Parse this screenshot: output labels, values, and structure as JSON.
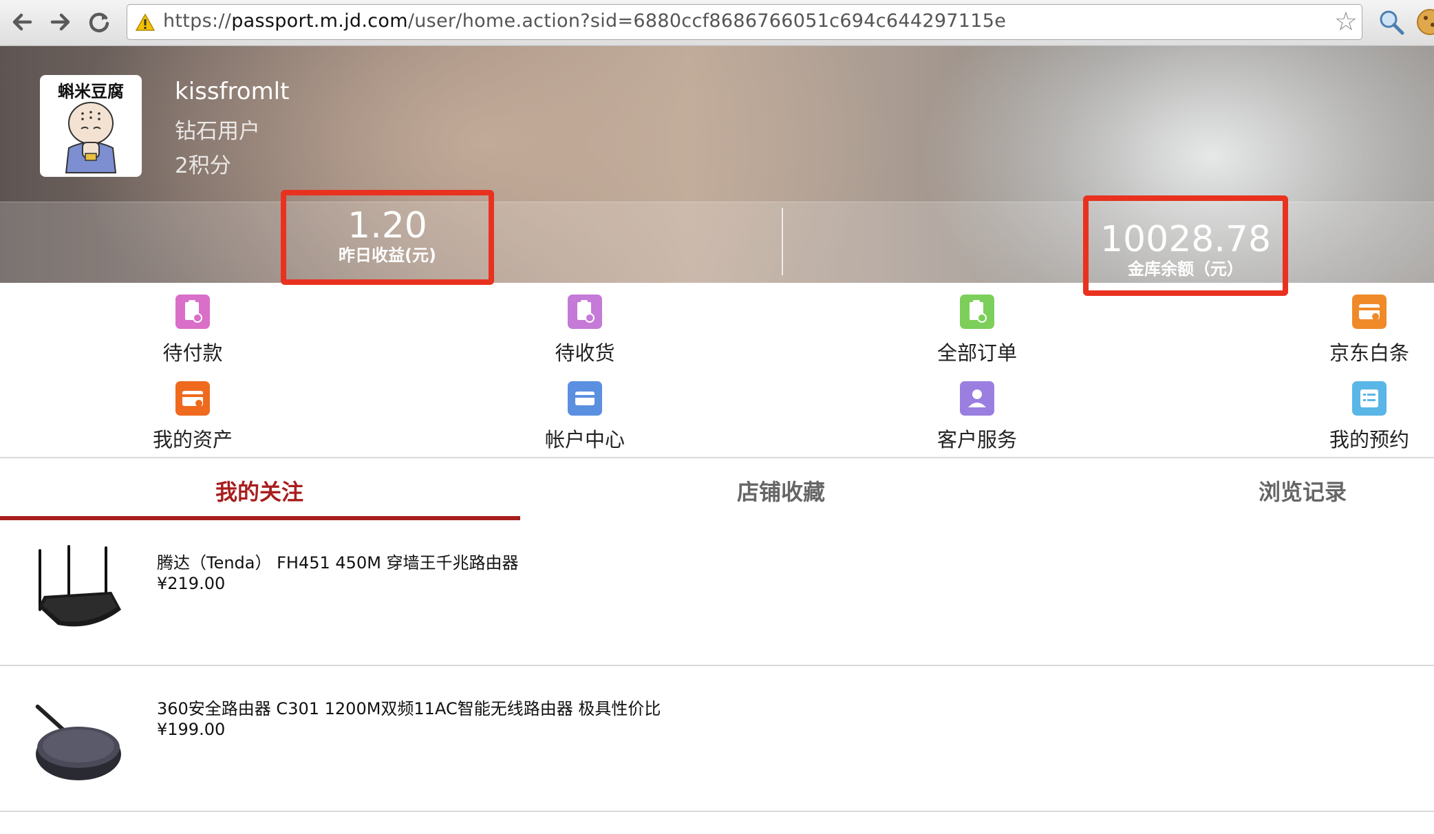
{
  "browser": {
    "url_scheme": "https://",
    "url_host": "passport.m.jd.com",
    "url_path": "/user/home.action?sid=6880ccf8686766051c694c644297115e"
  },
  "profile": {
    "avatar_caption": "蝌米豆腐",
    "username": "kissfromlt",
    "level": "钻石用户",
    "points": "2积分"
  },
  "stats": {
    "yesterday_value": "1.20",
    "yesterday_label": "昨日收益(元)",
    "vault_value": "10028.78",
    "vault_label": "金库余额（元）"
  },
  "menu": [
    {
      "label": "待付款",
      "icon": "pending-payment-icon",
      "color": "#d96fc8"
    },
    {
      "label": "待收货",
      "icon": "pending-receipt-icon",
      "color": "#c47ad6"
    },
    {
      "label": "全部订单",
      "icon": "all-orders-icon",
      "color": "#7ccf5a"
    },
    {
      "label": "京东白条",
      "icon": "jd-baitiao-icon",
      "color": "#f08a28"
    },
    {
      "label": "我的资产",
      "icon": "my-assets-icon",
      "color": "#ef6a1e"
    },
    {
      "label": "帐户中心",
      "icon": "account-center-icon",
      "color": "#5b8fe0"
    },
    {
      "label": "客户服务",
      "icon": "customer-service-icon",
      "color": "#9a7fe0"
    },
    {
      "label": "我的预约",
      "icon": "my-reservations-icon",
      "color": "#5ab6e6"
    }
  ],
  "tabs": [
    {
      "label": "我的关注",
      "active": true
    },
    {
      "label": "店铺收藏",
      "active": false
    },
    {
      "label": "浏览记录",
      "active": false
    }
  ],
  "products": [
    {
      "title": "腾达（Tenda） FH451 450M 穿墙王千兆路由器",
      "price": "¥219.00",
      "image": "router-icon"
    },
    {
      "title": "360安全路由器 C301 1200M双频11AC智能无线路由器 极具性价比",
      "price": "¥199.00",
      "image": "router-icon"
    }
  ],
  "colors": {
    "highlight_box": "#e8321f",
    "active_tab": "#a81e1e"
  }
}
